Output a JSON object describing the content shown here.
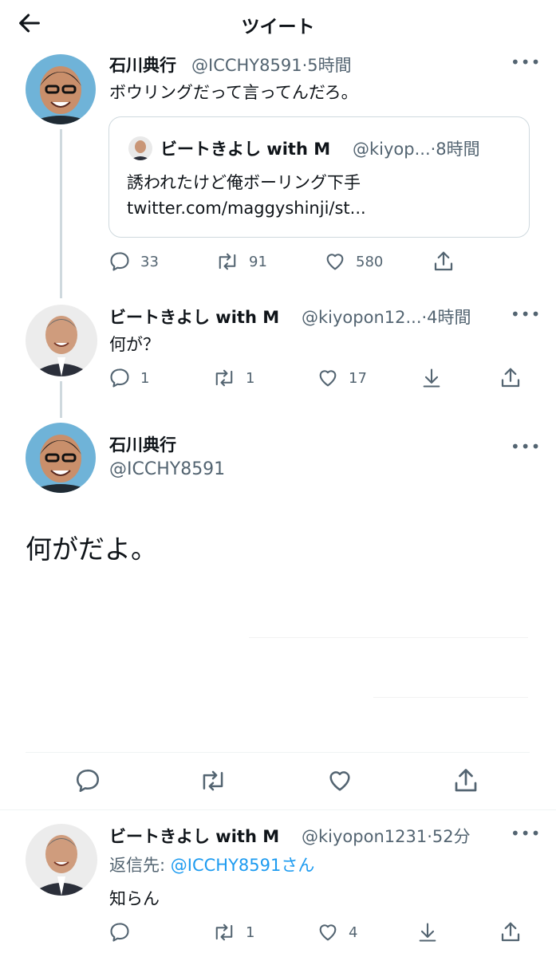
{
  "header": {
    "title": "ツイート"
  },
  "tweet1": {
    "name": "石川典行",
    "meta": "@ICCHY8591·5時間",
    "text": "ボウリングだって言ってんだろ。",
    "quote": {
      "name": "ビートきよし with M",
      "meta": "@kiyop...·8時間",
      "text1": "誘われたけど俺ボーリング下手",
      "text2": "twitter.com/maggyshinji/st..."
    },
    "replies": "33",
    "retweets": "91",
    "likes": "580"
  },
  "tweet2": {
    "name": "ビートきよし with M",
    "meta": "@kiyopon12...·4時間",
    "text": "何が？",
    "replies": "1",
    "retweets": "1",
    "likes": "17"
  },
  "main": {
    "name": "石川典行",
    "handle": "@ICCHY8591",
    "text": "何がだよ。"
  },
  "reply": {
    "name": "ビートきよし with M",
    "meta": "@kiyopon1231·52分",
    "replying_prefix": "返信先: ",
    "replying_to": "@ICCHY8591さん",
    "text": "知らん",
    "retweets": "1",
    "likes": "4"
  },
  "icons": {
    "back": "arrow-left-icon",
    "reply": "speech-bubble-icon",
    "retweet": "retweet-icon",
    "like": "heart-icon",
    "share": "share-icon",
    "download": "download-icon",
    "more": "more-dots-icon"
  },
  "colors": {
    "link": "#1d9bf0",
    "secondary": "#536471",
    "border": "#cfd9de"
  }
}
